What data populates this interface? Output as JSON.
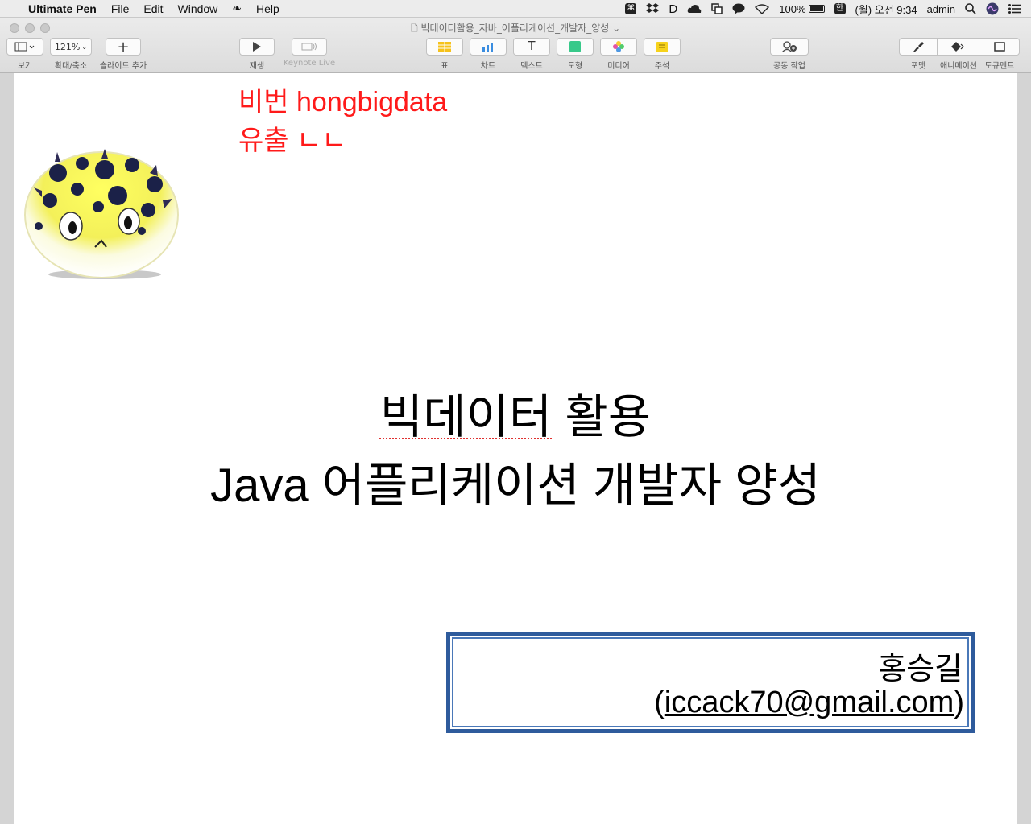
{
  "menubar": {
    "app_name": "Ultimate Pen",
    "items": [
      "File",
      "Edit",
      "Window",
      "Help"
    ],
    "battery": "100%",
    "input_method": "한",
    "clock": "(월) 오전 9:34",
    "user": "admin"
  },
  "window": {
    "doc_title": "빅데이터활용_자바_어플리케이션_개발자_양성 ⌄"
  },
  "toolbar": {
    "view_label": "보기",
    "zoom_value": "121%",
    "zoom_label": "확대/축소",
    "add_slide_label": "슬라이드 추가",
    "play_label": "재생",
    "keynote_live_label": "Keynote Live",
    "table_label": "표",
    "chart_label": "차트",
    "text_label": "텍스트",
    "shape_label": "도형",
    "media_label": "미디어",
    "comment_label": "주석",
    "collab_label": "공동 작업",
    "format_label": "포맷",
    "animate_label": "애니메이션",
    "document_label": "도큐멘트"
  },
  "slide": {
    "annotation_line1": "비번 hongbigdata",
    "annotation_line2": "유출 ㄴㄴ",
    "title_word1": "빅데이터",
    "title_word2": "활용",
    "title_line2": "Java 어플리케이션 개발자 양성",
    "author_name": "홍승길",
    "email_open": "(",
    "email": "iccack70@gmail.com",
    "email_close": ")"
  },
  "colors": {
    "annotation": "#ff1a1a",
    "author_border": "#2e5b9c"
  }
}
